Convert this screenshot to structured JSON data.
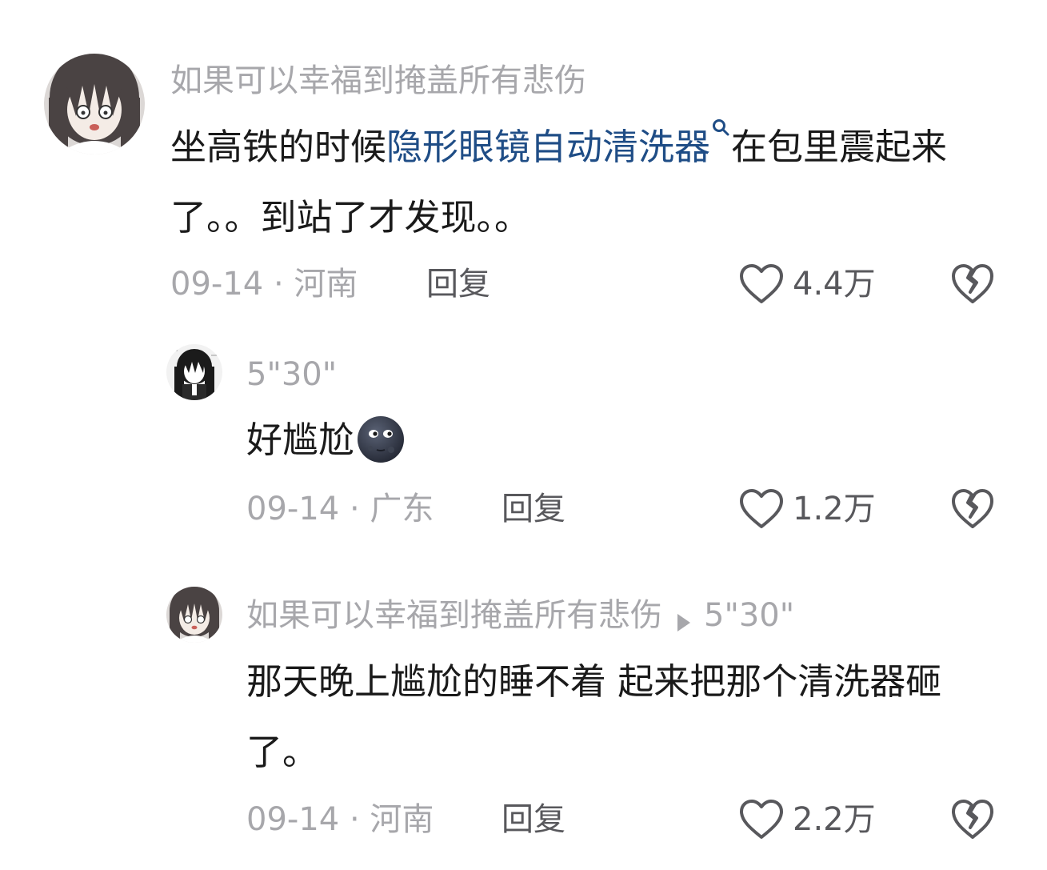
{
  "colors": {
    "username": "#a7a7ab",
    "body_text": "#1a1a1a",
    "link": "#1f4d86",
    "meta": "#a7a7ab",
    "action": "#58585c"
  },
  "comments": [
    {
      "username": "如果可以幸福到掩盖所有悲伤",
      "text_before": "坐高铁的时候",
      "link_text": "隐形眼镜自动清洗器",
      "link_icon": "search-icon",
      "text_after": "在包里震起来了。。到站了才发现。。",
      "date": "09-14",
      "separator": "·",
      "location": "河南",
      "reply_label": "回复",
      "like_count": "4.4万",
      "like_icon": "heart-outline-icon",
      "dislike_icon": "broken-heart-icon"
    }
  ],
  "replies": [
    {
      "username": "5\"30\"",
      "text": "好尴尬",
      "emoji": "new-moon-face-emoji",
      "date": "09-14",
      "separator": "·",
      "location": "广东",
      "reply_label": "回复",
      "like_count": "1.2万"
    },
    {
      "username": "如果可以幸福到掩盖所有悲伤",
      "reply_to_icon": "play-arrow-icon",
      "reply_to": "5\"30\"",
      "text": "那天晚上尴尬的睡不着 起来把那个清洗器砸了。",
      "date": "09-14",
      "separator": "·",
      "location": "河南",
      "reply_label": "回复",
      "like_count": "2.2万"
    }
  ]
}
